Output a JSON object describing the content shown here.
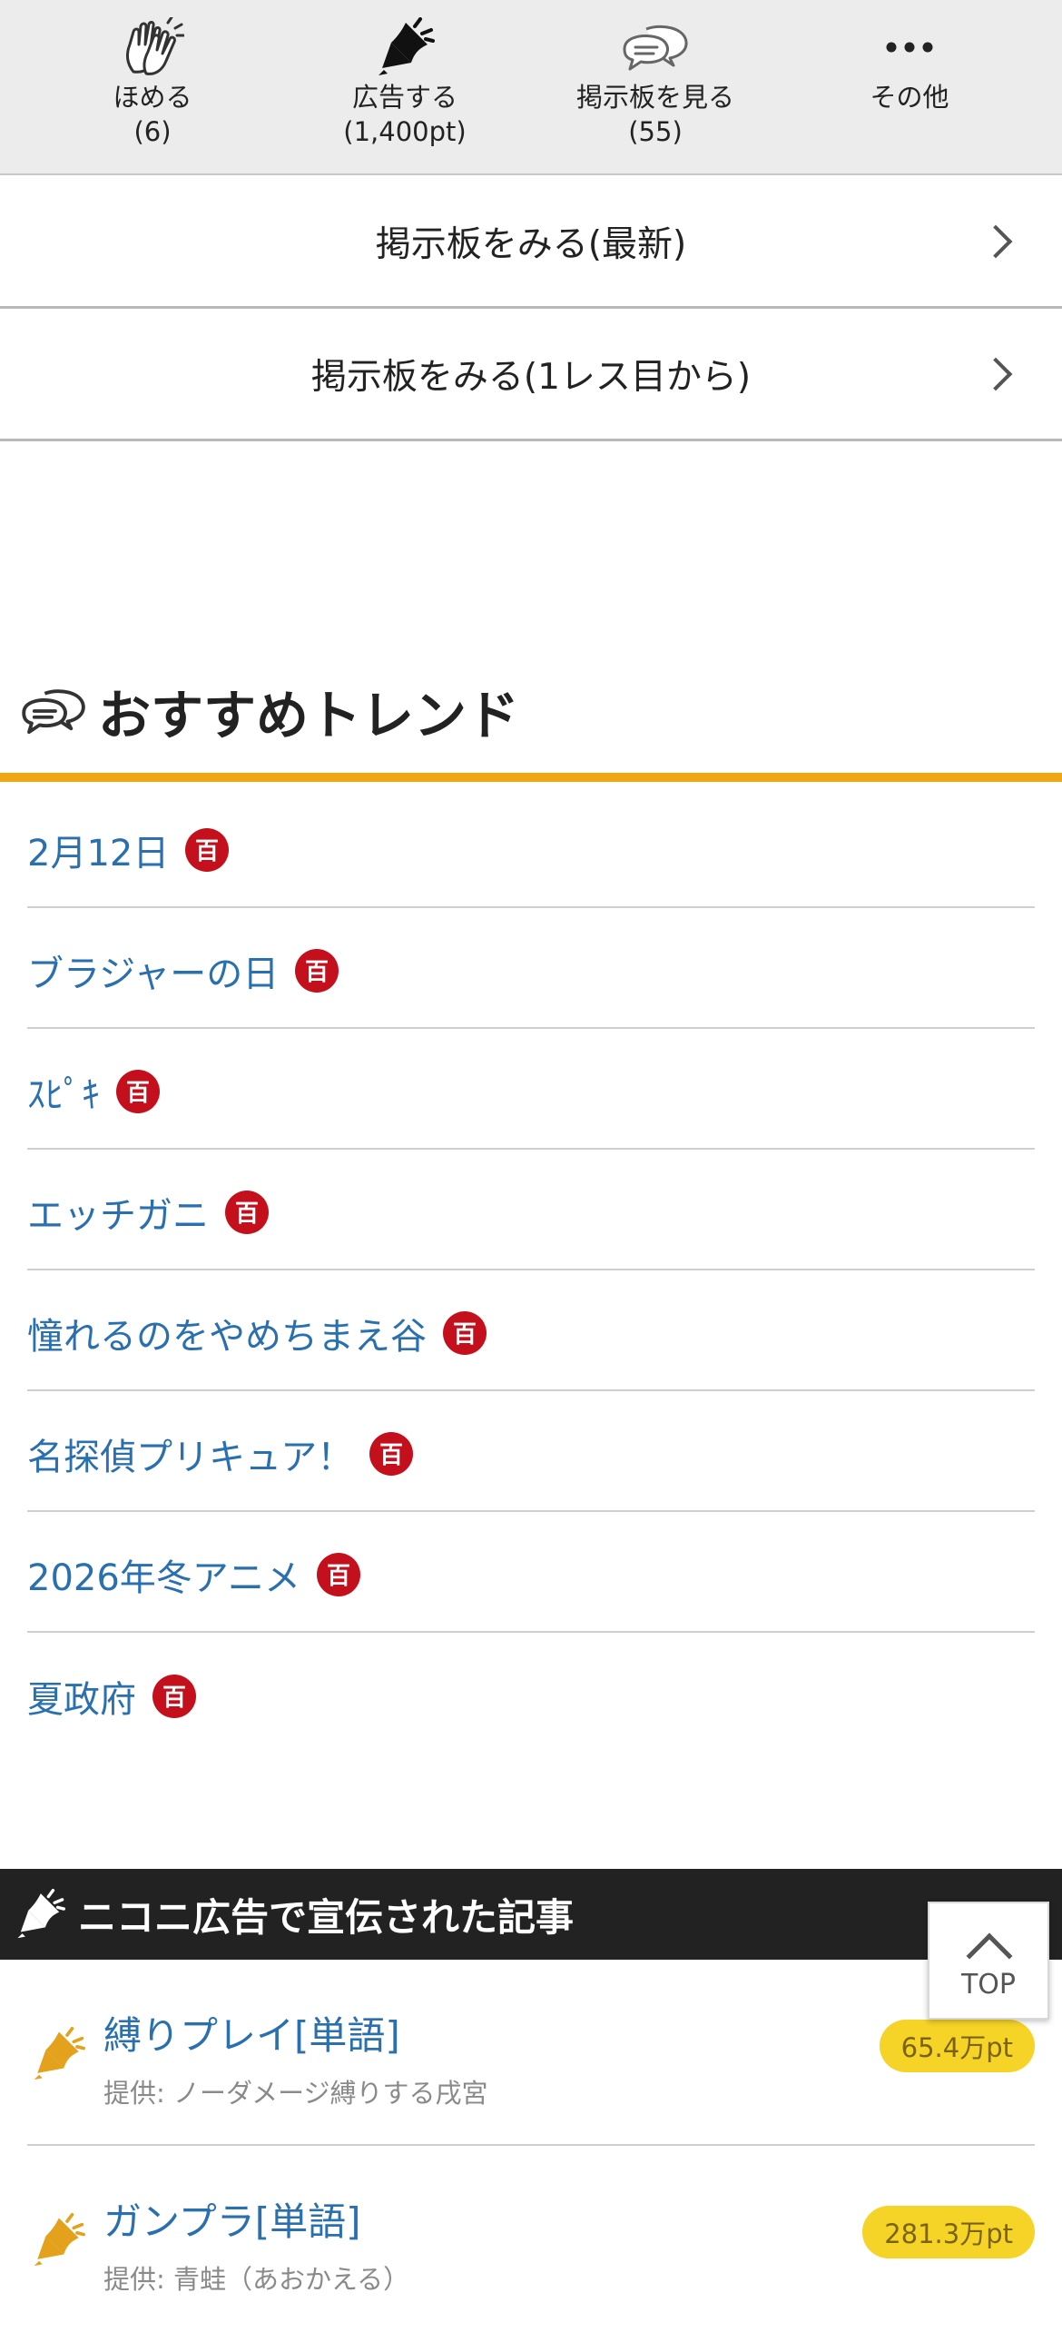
{
  "actions": [
    {
      "label": "ほめる",
      "count": "(6)",
      "icon": "clapping-hands-icon"
    },
    {
      "label": "広告する",
      "count": "(1,400pt)",
      "icon": "megaphone-icon"
    },
    {
      "label": "掲示板を見る",
      "count": "(55)",
      "icon": "speech-bubbles-icon"
    },
    {
      "label": "その他",
      "count": "",
      "icon": "more-dots-icon"
    }
  ],
  "board_links": {
    "latest": "掲示板をみる(最新)",
    "from_first": "掲示板をみる(1レス目から)"
  },
  "trends": {
    "title": "おすすめトレンド",
    "icon": "speech-bubbles-icon",
    "accent_color": "#f3a614",
    "badge_icon": "hyaku-badge-icon",
    "badge_text": "百",
    "items": [
      {
        "label": "2月12日"
      },
      {
        "label": "ブラジャーの日"
      },
      {
        "label": "ｽﾋﾟｷ"
      },
      {
        "label": "エッチガニ"
      },
      {
        "label": "憧れるのをやめちまえ谷"
      },
      {
        "label": "名探偵プリキュア！"
      },
      {
        "label": "2026年冬アニメ"
      },
      {
        "label": "夏政府"
      }
    ]
  },
  "ads": {
    "title": "ニコニ広告で宣伝された記事",
    "icon": "megaphone-icon",
    "items": [
      {
        "title": "縛りプレイ[単語]",
        "sponsor": "提供: ノーダメージ縛りする戌宮",
        "points": "65.4万pt"
      },
      {
        "title": "ガンプラ[単語]",
        "sponsor": "提供: 青蛙（あおかえる）",
        "points": "281.3万pt"
      }
    ]
  },
  "top_button": {
    "label": "TOP",
    "icon": "chevron-up-icon"
  },
  "colors": {
    "link": "#2a6fae",
    "badge": "#c3101c",
    "points_bg": "#f5d327"
  }
}
